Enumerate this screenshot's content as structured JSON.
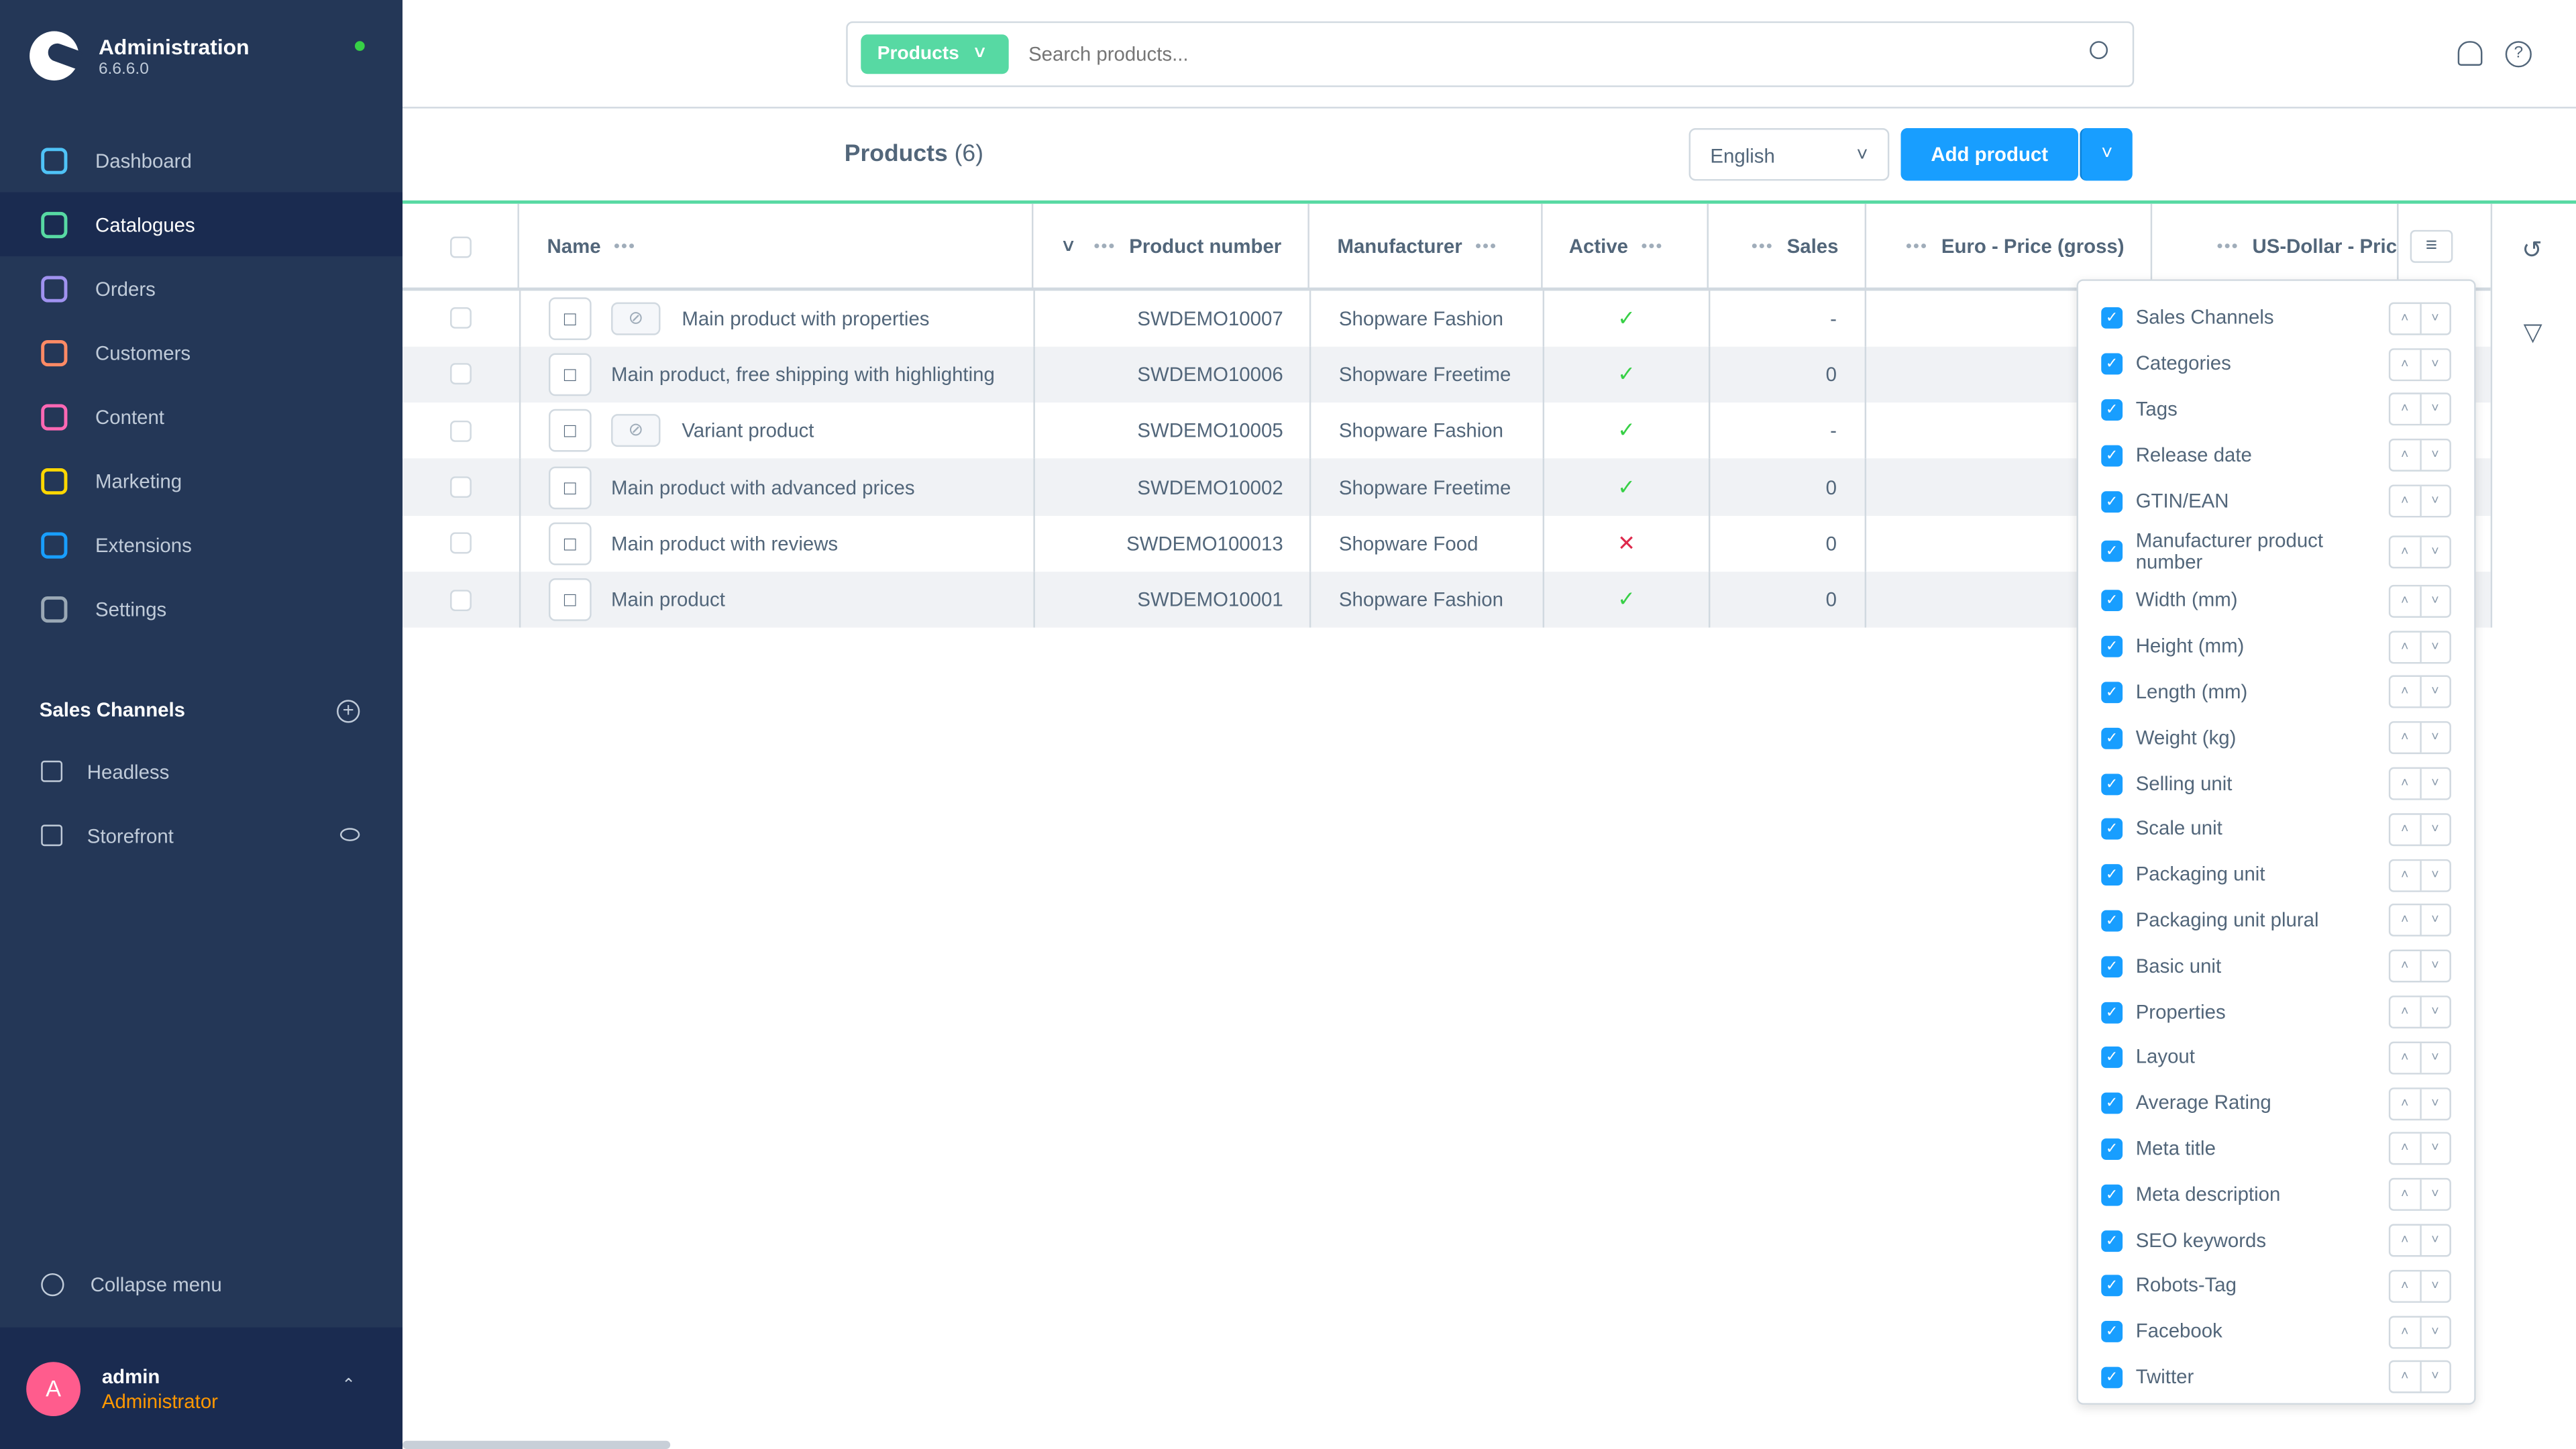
{
  "app": {
    "title": "Administration",
    "version": "6.6.6.0",
    "status_color": "#37d046"
  },
  "sidebar": {
    "items": [
      {
        "label": "Dashboard",
        "icon": "dashboard-icon",
        "color": "#4fc3f7"
      },
      {
        "label": "Catalogues",
        "icon": "catalogues-icon",
        "color": "#57d9a3",
        "active": true
      },
      {
        "label": "Orders",
        "icon": "orders-icon",
        "color": "#a092f0"
      },
      {
        "label": "Customers",
        "icon": "customers-icon",
        "color": "#ff8a65"
      },
      {
        "label": "Content",
        "icon": "content-icon",
        "color": "#ff68b4"
      },
      {
        "label": "Marketing",
        "icon": "marketing-icon",
        "color": "#ffd700"
      },
      {
        "label": "Extensions",
        "icon": "extensions-icon",
        "color": "#189eff"
      },
      {
        "label": "Settings",
        "icon": "settings-icon",
        "color": "#9aa8b5"
      }
    ],
    "sales_channels_title": "Sales Channels",
    "sales_channels": [
      {
        "label": "Headless"
      },
      {
        "label": "Storefront"
      }
    ],
    "collapse_label": "Collapse menu",
    "user": {
      "initial": "A",
      "name": "admin",
      "role": "Administrator"
    }
  },
  "search": {
    "module": "Products",
    "placeholder": "Search products..."
  },
  "page": {
    "title": "Products",
    "count": "(6)",
    "language": "English",
    "add_label": "Add product"
  },
  "table": {
    "columns": [
      "Name",
      "Product number",
      "Manufacturer",
      "Active",
      "Sales",
      "Euro - Price (gross)",
      "US-Dollar - Pric"
    ],
    "rows": [
      {
        "name": "Main product with properties",
        "variant": true,
        "number": "SWDEMO10007",
        "manufacturer": "Shopware Fashion",
        "active": true,
        "sales": "-"
      },
      {
        "name": "Main product, free shipping with highlighting",
        "variant": false,
        "number": "SWDEMO10006",
        "manufacturer": "Shopware Freetime",
        "active": true,
        "sales": "0"
      },
      {
        "name": "Variant product",
        "variant": true,
        "number": "SWDEMO10005",
        "manufacturer": "Shopware Fashion",
        "active": true,
        "sales": "-"
      },
      {
        "name": "Main product with advanced prices",
        "variant": false,
        "number": "SWDEMO10002",
        "manufacturer": "Shopware Freetime",
        "active": true,
        "sales": "0"
      },
      {
        "name": "Main product with reviews",
        "variant": false,
        "number": "SWDEMO100013",
        "manufacturer": "Shopware Food",
        "active": false,
        "sales": "0"
      },
      {
        "name": "Main product",
        "variant": false,
        "number": "SWDEMO10001",
        "manufacturer": "Shopware Fashion",
        "active": true,
        "sales": "0"
      }
    ]
  },
  "column_settings": [
    "Sales Channels",
    "Categories",
    "Tags",
    "Release date",
    "GTIN/EAN",
    "Manufacturer product number",
    "Width (mm)",
    "Height (mm)",
    "Length (mm)",
    "Weight (kg)",
    "Selling unit",
    "Scale unit",
    "Packaging unit",
    "Packaging unit plural",
    "Basic unit",
    "Properties",
    "Layout",
    "Average Rating",
    "Meta title",
    "Meta description",
    "SEO keywords",
    "Robots-Tag",
    "Facebook",
    "Twitter"
  ]
}
